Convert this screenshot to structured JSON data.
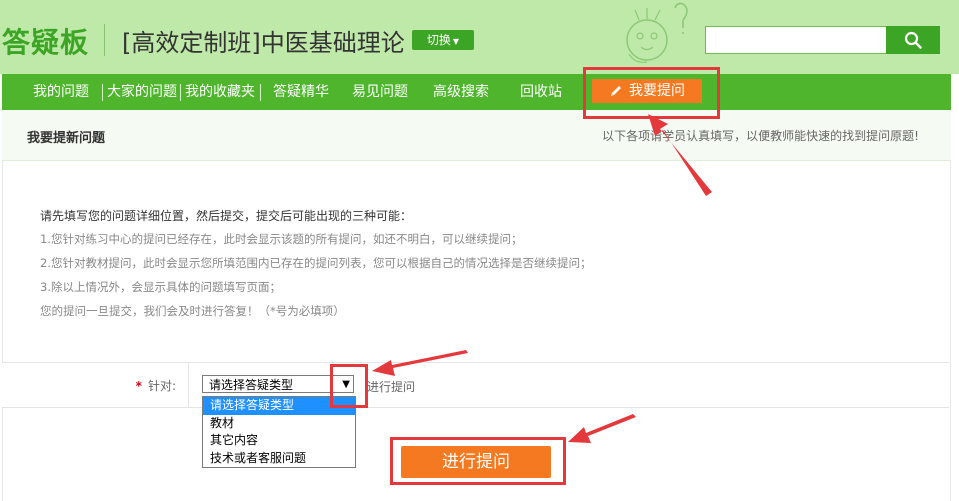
{
  "header": {
    "logo": "答疑板",
    "course_title": "[高效定制班]中医基础理论",
    "switch_label": "切换",
    "search": {
      "value": "",
      "button_icon": "search-icon"
    }
  },
  "nav": {
    "items": [
      {
        "label": "我的问题"
      },
      {
        "label": "大家的问题"
      },
      {
        "label": "我的收藏夹"
      },
      {
        "label": "答疑精华"
      },
      {
        "label": "易见问题"
      },
      {
        "label": "高级搜索"
      },
      {
        "label": "回收站"
      }
    ],
    "ask_button": {
      "label": "我要提问",
      "icon": "pencil-icon"
    }
  },
  "subheader": {
    "title": "我要提新问题",
    "tip": "以下各项请学员认真填写，以便教师能快速的找到提问原题!"
  },
  "intro": {
    "heading": "请先填写您的问题详细位置，然后提交，提交后可能出现的三种可能：",
    "lines": [
      "1.您针对练习中心的提问已经存在，此时会显示该题的所有提问，如还不明白，可以继续提问；",
      "2.您针对教材提问，此时会显示您所填范围内已存在的提问列表，您可以根据自己的情况选择是否继续提问；",
      "3.除以上情况外，会显示具体的问题填写页面；",
      "您的提问一旦提交，我们会及时进行答复！（*号为必填项）"
    ]
  },
  "form": {
    "required_mark": "*",
    "label": "针对:",
    "select_value": "请选择答疑类型",
    "after_select_text": "进行提问",
    "options": [
      "请选择答疑类型",
      "教材",
      "其它内容",
      "技术或者客服问题"
    ]
  },
  "submit_label": "进行提问",
  "colors": {
    "header_bg": "#bfe9a8",
    "brand_green": "#3da525",
    "nav_green": "#4eb52d",
    "accent_orange": "#f47920",
    "annotation_red": "#e4393c",
    "selected_option": "#1e90ff"
  }
}
